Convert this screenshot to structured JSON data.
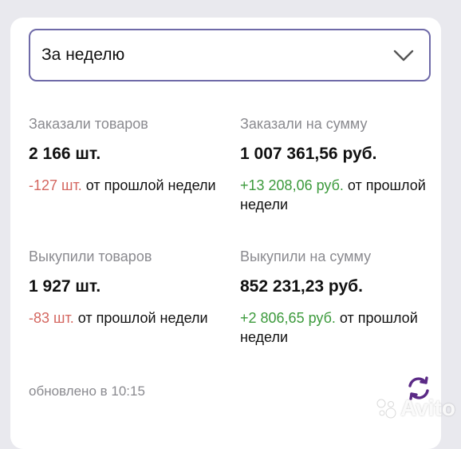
{
  "period": {
    "selected": "За неделю",
    "icon": "chevron-down-icon"
  },
  "stats": {
    "ordered_items": {
      "label": "Заказали товаров",
      "value": "2 166 шт.",
      "delta": "-127 шт.",
      "delta_suffix": " от прошлой недели"
    },
    "ordered_sum": {
      "label": "Заказали на сумму",
      "value": "1 007 361,56 руб.",
      "delta": "+13 208,06 руб.",
      "delta_suffix": " от прошлой недели"
    },
    "bought_items": {
      "label": "Выкупили товаров",
      "value": "1 927 шт.",
      "delta": "-83 шт.",
      "delta_suffix": " от прошлой недели"
    },
    "bought_sum": {
      "label": "Выкупили на сумму",
      "value": "852 231,23 руб.",
      "delta": "+2 806,65 руб.",
      "delta_suffix": " от прошлой недели"
    }
  },
  "footer": {
    "updated": "обновлено в 10:15",
    "refresh_icon": "refresh-icon"
  },
  "watermark": "Avito",
  "colors": {
    "accent": "#5b2a86",
    "negative": "#d4665f",
    "positive": "#3c9a3c",
    "border": "#6f6aa8"
  }
}
